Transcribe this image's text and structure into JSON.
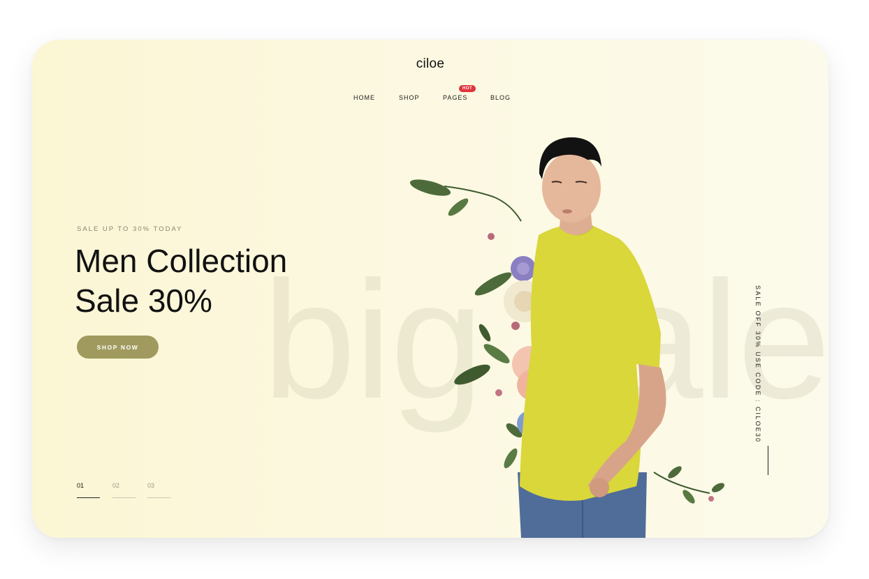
{
  "brand": {
    "name": "ciloe"
  },
  "nav": {
    "items": [
      {
        "label": "HOME"
      },
      {
        "label": "SHOP",
        "badge": "HOT"
      },
      {
        "label": "PAGES"
      },
      {
        "label": "BLOG"
      }
    ]
  },
  "hero": {
    "eyebrow": "SALE UP TO 30% TODAY",
    "title_line1": "Men Collection",
    "title_line2": "Sale 30%",
    "cta_label": "SHOP NOW",
    "watermark": "big sale",
    "side_text": "SALE OFF 30% USE CODE : CILOE30"
  },
  "slider": {
    "items": [
      {
        "label": "01"
      },
      {
        "label": "02"
      },
      {
        "label": "03"
      }
    ],
    "active_index": 0
  },
  "colors": {
    "accent_button": "#a09a5e",
    "hot_badge": "#e0343d",
    "tshirt": "#d9d73a",
    "jeans": "#4f6d98"
  },
  "icons": {
    "model_image": "man-in-yellow-tshirt-with-flowers"
  }
}
